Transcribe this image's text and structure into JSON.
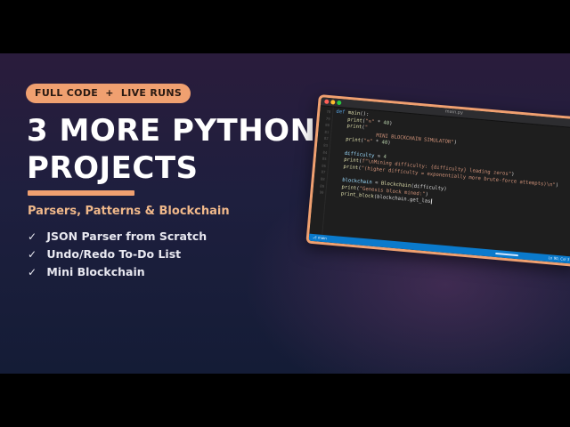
{
  "badge": {
    "left": "FULL CODE",
    "sep": "+",
    "right": "LIVE RUNS"
  },
  "title": {
    "line1": "3 MORE PYTHON",
    "line2": "PROJECTS"
  },
  "subtitle": "Parsers, Patterns & Blockchain",
  "checklist": {
    "mark": "✓",
    "items": [
      "JSON Parser from Scratch",
      "Undo/Redo To-Do List",
      "Mini Blockchain"
    ]
  },
  "editor": {
    "window_title": "main.py",
    "code": {
      "l1_kw": "def ",
      "l1_fn": "main",
      "l1_rest": "():",
      "l2_fn": "print",
      "l2_str": "\"=\"",
      "l2_op": " * ",
      "l2_num": "40",
      "l3_fn": "print",
      "l3_str": "\"",
      "l4_str": "MINI BLOCKCHAIN SIMULATOR\"",
      "l5_fn": "print",
      "l5_str": "\"=\"",
      "l5_op": " * ",
      "l5_num": "40",
      "l6_vr": "difficulty",
      "l6_op": " = ",
      "l6_num": "4",
      "l7_fn": "print",
      "l7_str": "f\"\\nMining difficulty: {difficulty} leading zeros\"",
      "l8_fn": "print",
      "l8_str": "\"(higher difficulty = exponentially more brute-force attempts)\\n\"",
      "l9_vr": "blockchain",
      "l9_op": " = ",
      "l9_fn": "Blockchain",
      "l9_rest": "(difficulty)",
      "l10_fn": "print",
      "l10_str": "\"Genesis block mined:\"",
      "l11_fn": "print_block",
      "l11_rest": "(blockchain.get_las"
    },
    "line_numbers": [
      "78",
      "79",
      "80",
      "81",
      "82",
      "83",
      "84",
      "85",
      "86",
      "87",
      "88",
      "89",
      "90"
    ],
    "status_left": "⎇ main",
    "status_right": "Ln 90, Col 37"
  },
  "colors": {
    "accent": "#f0a070",
    "background_top": "#2a1c3c",
    "background_bottom": "#141c36",
    "editor_bg": "#1e1e1e",
    "statusbar": "#0a7acc"
  }
}
